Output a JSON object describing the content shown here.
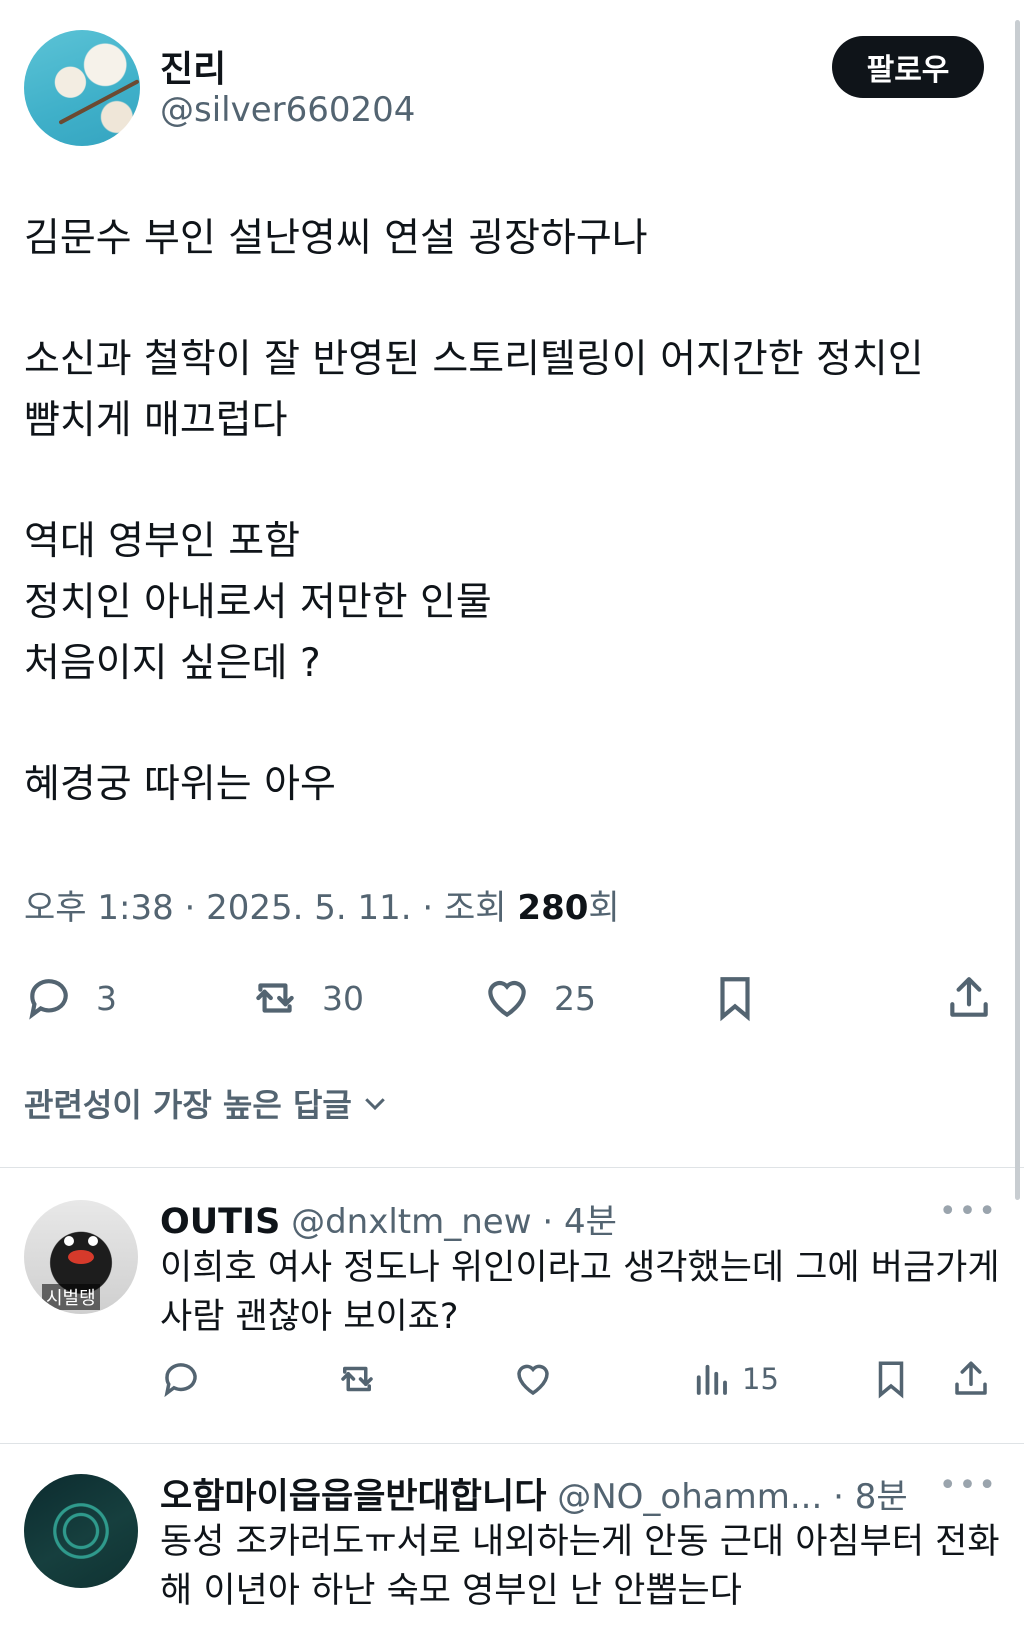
{
  "post": {
    "author": {
      "display_name": "진리",
      "handle": "@silver660204"
    },
    "follow_label": "팔로우",
    "body": {
      "line1": "김문수 부인 설난영씨 연설 굉장하구나",
      "line2": "소신과 철학이 잘 반영된 스토리텔링이 어지간한 정치인",
      "line3": "뺨치게 매끄럽다",
      "line4": "역대 영부인 포함",
      "line5": "정치인 아내로서 저만한 인물",
      "line6": "처음이지 싶은데 ?",
      "line7": "혜경궁 따위는 아우"
    },
    "meta": {
      "time_date": "오후 1:38 · 2025. 5. 11. · 조회 ",
      "views": "280",
      "views_suffix": "회"
    },
    "stats": {
      "replies": "3",
      "reposts": "30",
      "likes": "25"
    },
    "icons": [
      "reply-icon",
      "repost-icon",
      "like-icon",
      "bookmark-icon",
      "share-icon"
    ]
  },
  "sort_label": "관련성이 가장 높은 답글",
  "replies": [
    {
      "name": "OUTIS",
      "handle": "@dnxltm_new",
      "time": "· 4분",
      "text": "이희호 여사 정도나 위인이라고 생각했는데 그에 버금가게 사람 괜찮아 보이죠?",
      "avatar_tag": "시벌탱",
      "views": "15",
      "more": "•••"
    },
    {
      "name": "오함마이읍읍을반대합니다",
      "handle": "@NO_ohamm...",
      "time": "· 8분",
      "text": "동성 조카러도ㅠ서로 내외하는게 안동 근대 아침부터 전화해 이년아 하난 숙모 영부인 난 안뽑는다",
      "more": "•••"
    }
  ]
}
